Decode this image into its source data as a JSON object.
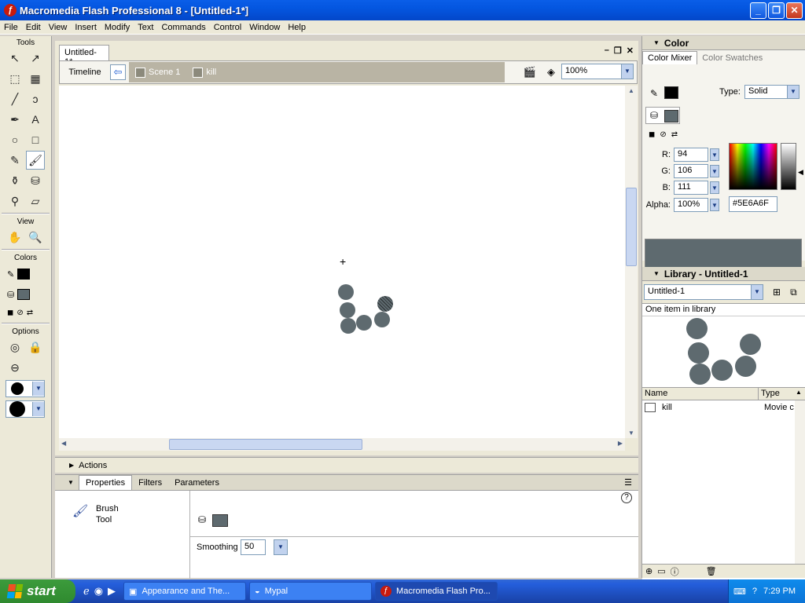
{
  "window": {
    "title": "Macromedia Flash Professional 8 - [Untitled-1*]"
  },
  "menu": [
    "File",
    "Edit",
    "View",
    "Insert",
    "Modify",
    "Text",
    "Commands",
    "Control",
    "Window",
    "Help"
  ],
  "tools": {
    "label": "Tools",
    "view_label": "View",
    "colors_label": "Colors",
    "options_label": "Options",
    "items": [
      {
        "name": "arrow-tool",
        "glyph": "↖"
      },
      {
        "name": "subselect-tool",
        "glyph": "↗"
      },
      {
        "name": "free-transform-tool",
        "glyph": "⬚"
      },
      {
        "name": "fill-transform-tool",
        "glyph": "▦"
      },
      {
        "name": "line-tool",
        "glyph": "╱"
      },
      {
        "name": "lasso-tool",
        "glyph": "ↄ"
      },
      {
        "name": "pen-tool",
        "glyph": "✒"
      },
      {
        "name": "text-tool",
        "glyph": "A"
      },
      {
        "name": "oval-tool",
        "glyph": "○"
      },
      {
        "name": "rectangle-tool",
        "glyph": "□"
      },
      {
        "name": "pencil-tool",
        "glyph": "✎"
      },
      {
        "name": "brush-tool",
        "glyph": "🖌"
      },
      {
        "name": "ink-bottle-tool",
        "glyph": "⚱"
      },
      {
        "name": "paint-bucket-tool",
        "glyph": "⛁"
      },
      {
        "name": "eyedropper-tool",
        "glyph": "⚲"
      },
      {
        "name": "eraser-tool",
        "glyph": "▱"
      }
    ]
  },
  "document": {
    "tab": "Untitled-1*",
    "timeline_label": "Timeline",
    "scene": "Scene 1",
    "symbol": "kill",
    "zoom": "100%"
  },
  "stage_colors": {
    "shape": "#5e6a6f"
  },
  "actions_label": "Actions",
  "properties": {
    "tabs": [
      "Properties",
      "Filters",
      "Parameters"
    ],
    "tool_name_line1": "Brush",
    "tool_name_line2": "Tool",
    "smoothing_label": "Smoothing",
    "smoothing_value": "50"
  },
  "color_panel": {
    "title": "Color",
    "tabs": [
      "Color Mixer",
      "Color Swatches"
    ],
    "type_label": "Type:",
    "type_value": "Solid",
    "r_label": "R:",
    "r": "94",
    "g_label": "G:",
    "g": "106",
    "b_label": "B:",
    "b": "111",
    "alpha_label": "Alpha:",
    "alpha": "100%",
    "hex": "#5E6A6F"
  },
  "library": {
    "title": "Library - Untitled-1",
    "doc_select": "Untitled-1",
    "count_text": "One item in library",
    "col_name": "Name",
    "col_type": "Type",
    "item_name": "kill",
    "item_type": "Movie c"
  },
  "taskbar": {
    "start": "start",
    "tasks": [
      "Appearance and The...",
      "Mypal",
      "Macromedia Flash Pro..."
    ],
    "clock": "7:29 PM"
  }
}
